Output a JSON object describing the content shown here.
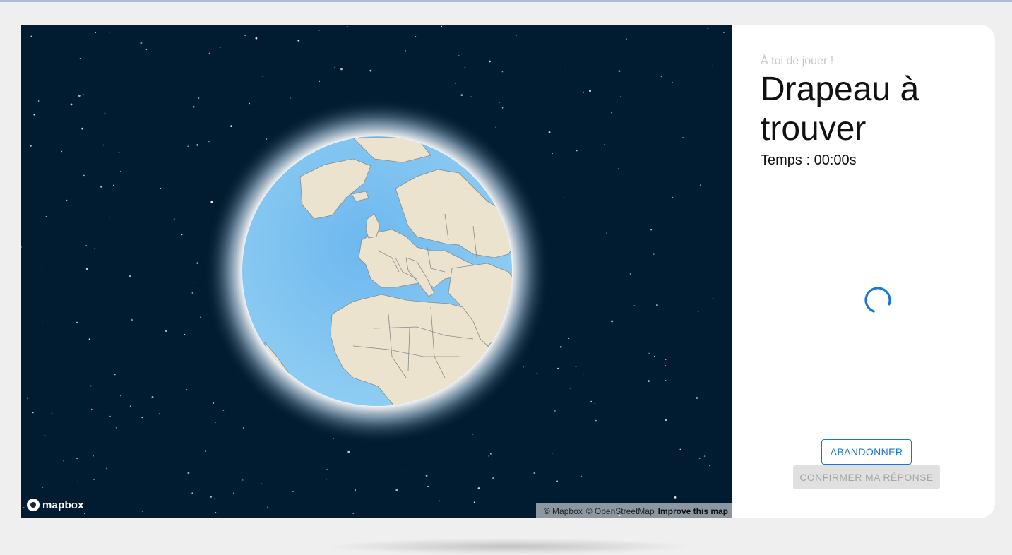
{
  "game": {
    "turn_label": "À toi de jouer !",
    "title": "Drapeau à trouver",
    "timer": "Temps : 00:00s",
    "buttons": {
      "abandon": "ABANDONNER",
      "confirm": "CONFIRMER MA RÉPONSE"
    }
  },
  "map": {
    "logo_text": "mapbox",
    "attribution": {
      "mapbox": "© Mapbox",
      "osm": "© OpenStreetMap",
      "improve": "Improve this map"
    },
    "colors": {
      "space": "#011b30",
      "ocean": "#7fc3ef",
      "land": "#ece3cf",
      "border": "#8a8a8a"
    }
  },
  "colors": {
    "accent": "#1976d2",
    "disabled_bg": "#e0e0e0",
    "disabled_text": "#a6a6a6"
  }
}
